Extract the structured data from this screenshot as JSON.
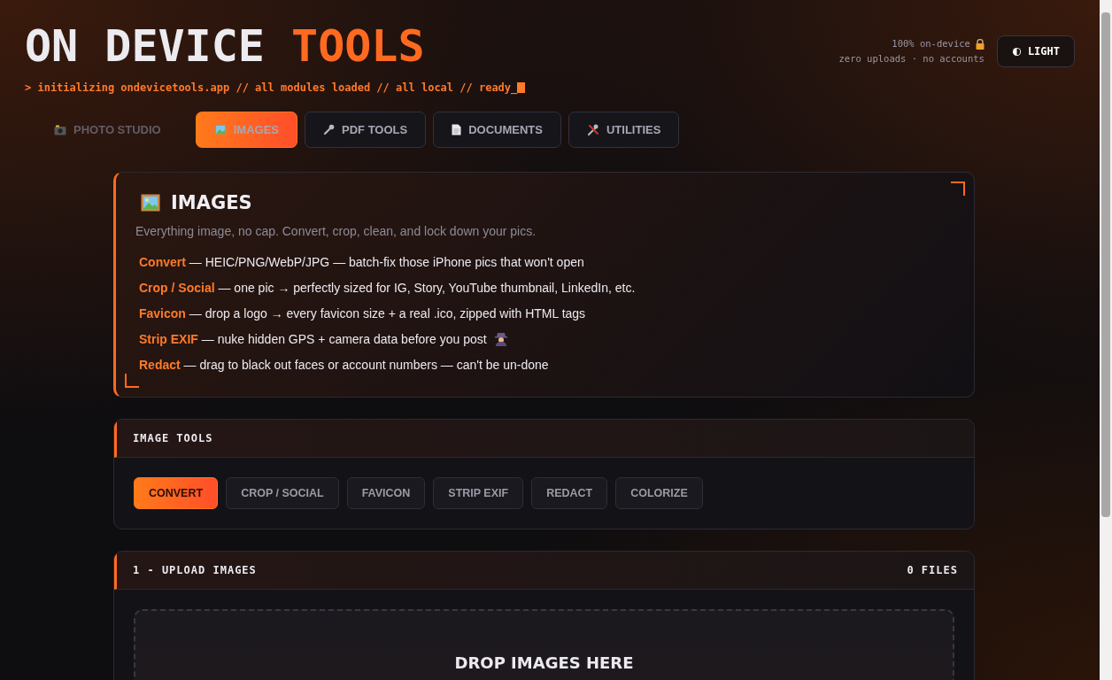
{
  "header": {
    "title_main": "ON DEVICE",
    "title_accent": "TOOLS",
    "terminal": "> initializing ondevicetools.app // all modules loaded // all local // ready_",
    "privacy_line_1": "100% on-device",
    "privacy_line_2": "zero uploads · no accounts",
    "theme_button": "LIGHT"
  },
  "tabs": [
    {
      "label": "PHOTO STUDIO",
      "kind": "plain",
      "selected": false
    },
    {
      "label": "IMAGES",
      "kind": "boxed",
      "selected": true
    },
    {
      "label": "PDF TOOLS",
      "kind": "boxed",
      "selected": false
    },
    {
      "label": "DOCUMENTS",
      "kind": "boxed",
      "selected": false
    },
    {
      "label": "UTILITIES",
      "kind": "boxed",
      "selected": false
    }
  ],
  "intro": {
    "title": "IMAGES",
    "subtitle": "Everything image, no cap. Convert, crop, clean, and lock down your pics.",
    "features": [
      {
        "text": "**Convert** — HEIC/PNG/WebP/JPG — batch-fix those iPhone pics that won't open",
        "trailing_icon": false
      },
      {
        "text": "**Crop / Social** — one pic → perfectly sized for IG, Story, YouTube thumbnail, LinkedIn, etc.",
        "trailing_icon": false
      },
      {
        "text": "**Favicon** — drop a logo → every favicon size + a real .ico, zipped with HTML tags",
        "trailing_icon": false
      },
      {
        "text": "**Strip EXIF** — nuke hidden GPS + camera data before you post",
        "trailing_icon": true
      },
      {
        "text": "**Redact** — drag to black out faces or account numbers — can't be un-done",
        "trailing_icon": false
      }
    ]
  },
  "image_tools": {
    "heading": "IMAGE TOOLS",
    "tools": [
      {
        "label": "CONVERT",
        "selected": true
      },
      {
        "label": "CROP / SOCIAL",
        "selected": false
      },
      {
        "label": "FAVICON",
        "selected": false
      },
      {
        "label": "STRIP EXIF",
        "selected": false
      },
      {
        "label": "REDACT",
        "selected": false
      },
      {
        "label": "COLORIZE",
        "selected": false
      }
    ]
  },
  "upload": {
    "heading": "1 - UPLOAD IMAGES",
    "count": "0 FILES",
    "drop_title": "DROP IMAGES HERE"
  }
}
